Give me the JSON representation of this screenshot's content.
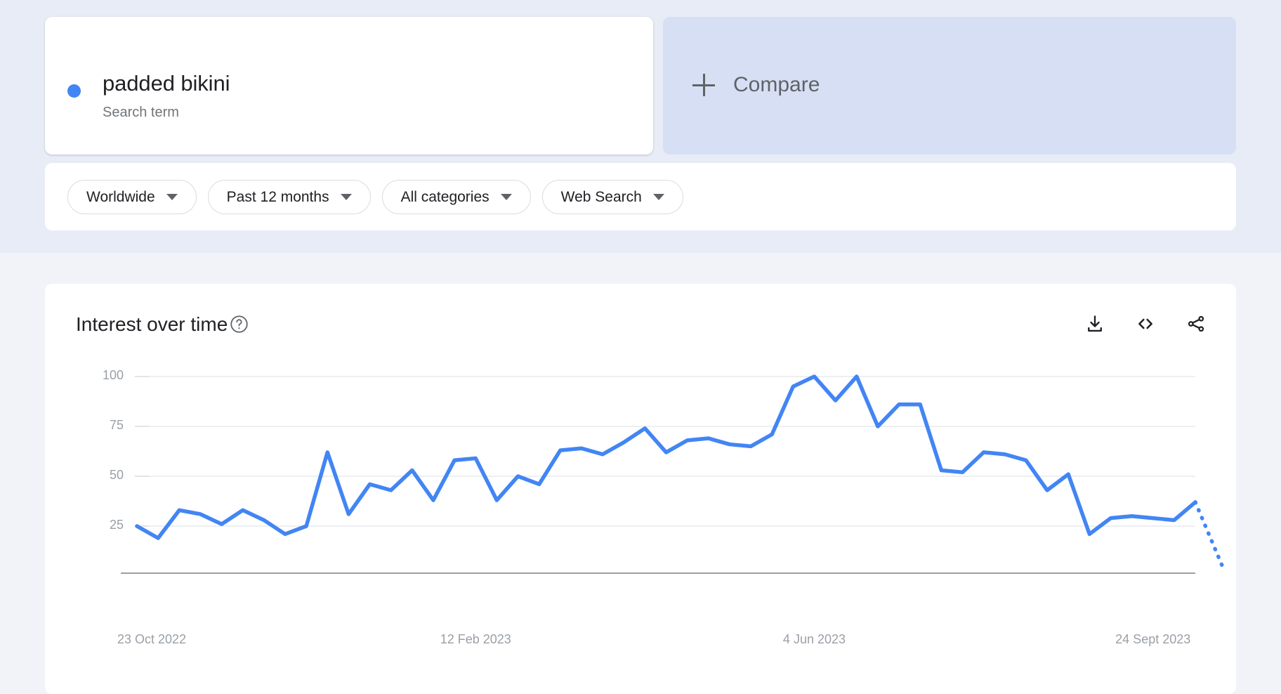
{
  "search_term": {
    "label": "padded bikini",
    "sublabel": "Search term",
    "dot_color": "#4285f4"
  },
  "compare": {
    "label": "Compare",
    "plus_icon": "plus-icon",
    "background": "#d7dff4"
  },
  "filters": [
    {
      "label": "Worldwide",
      "icon": "chevron-down-icon"
    },
    {
      "label": "Past 12 months",
      "icon": "chevron-down-icon"
    },
    {
      "label": "All categories",
      "icon": "chevron-down-icon"
    },
    {
      "label": "Web Search",
      "icon": "chevron-down-icon"
    }
  ],
  "chart_card": {
    "title": "Interest over time",
    "help_icon": "help-circle-icon",
    "actions": [
      {
        "name": "download-icon",
        "title": "Download"
      },
      {
        "name": "embed-code-icon",
        "title": "Embed"
      },
      {
        "name": "share-icon",
        "title": "Share"
      }
    ]
  },
  "chart_data": {
    "type": "line",
    "title": "Interest over time",
    "xlabel": "",
    "ylabel": "",
    "ylim": [
      0,
      100
    ],
    "yticks": [
      25,
      50,
      75,
      100
    ],
    "grid": true,
    "legend": false,
    "line_color": "#4285f4",
    "x_tick_labels": [
      "23 Oct 2022",
      "12 Feb 2023",
      "4 Jun 2023",
      "24 Sept 2023"
    ],
    "x_tick_indices": [
      0,
      16,
      32,
      48
    ],
    "series": [
      {
        "name": "padded bikini",
        "color": "#4285f4",
        "values": [
          25,
          19,
          33,
          31,
          26,
          33,
          28,
          21,
          25,
          62,
          31,
          46,
          43,
          53,
          38,
          58,
          59,
          38,
          50,
          46,
          63,
          64,
          61,
          67,
          74,
          62,
          68,
          69,
          66,
          65,
          71,
          95,
          100,
          88,
          100,
          75,
          86,
          86,
          53,
          52,
          62,
          61,
          58,
          43,
          51,
          21,
          29,
          30,
          29,
          28,
          37
        ],
        "partial_from_index": 50,
        "partial_values": [
          37,
          2
        ],
        "partial_note": "dotted segment indicates incomplete data"
      }
    ]
  }
}
